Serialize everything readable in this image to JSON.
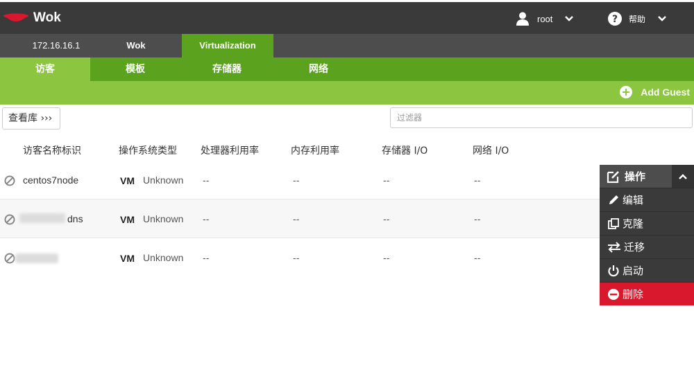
{
  "header": {
    "app_name": "Wok",
    "user": "root",
    "help_label": "帮助",
    "colors": {
      "topbar": "#3a3a3a",
      "logo": "#d9182d"
    }
  },
  "host_tabs": [
    {
      "label": "172.16.16.1"
    },
    {
      "label": "Wok"
    },
    {
      "label": "Virtualization",
      "active": true
    }
  ],
  "section_tabs": [
    {
      "label": "访客",
      "active": true
    },
    {
      "label": "模板"
    },
    {
      "label": "存储器"
    },
    {
      "label": "网络"
    }
  ],
  "actionbar": {
    "add_guest_label": "Add Guest"
  },
  "toolbar": {
    "gallery_label": "查看库 ›››",
    "filter_placeholder": "过滤器"
  },
  "table": {
    "columns": [
      "访客名称标识",
      "操作系统类型",
      "处理器利用率",
      "内存利用率",
      "存储器 I/O",
      "网络 I/O"
    ],
    "rows": [
      {
        "name": "centos7node",
        "os_badge": "VM",
        "os_type": "Unknown",
        "cpu": "--",
        "memory": "--",
        "storage_io": "--",
        "network_io": "--"
      },
      {
        "name": "dns",
        "os_badge": "VM",
        "os_type": "Unknown",
        "cpu": "--",
        "memory": "--",
        "storage_io": "--",
        "network_io": "--"
      },
      {
        "name": "",
        "os_badge": "VM",
        "os_type": "Unknown",
        "cpu": "--",
        "memory": "--",
        "storage_io": "--",
        "network_io": "--"
      }
    ]
  },
  "actions_menu": {
    "title": "操作",
    "items": [
      {
        "label": "编辑",
        "icon": "pencil-icon"
      },
      {
        "label": "克隆",
        "icon": "clone-icon"
      },
      {
        "label": "迁移",
        "icon": "migrate-icon"
      },
      {
        "label": "启动",
        "icon": "power-icon"
      },
      {
        "label": "删除",
        "icon": "minus-circle-icon",
        "danger": true
      }
    ]
  },
  "colors": {
    "primary_green": "#5ba21f",
    "light_green": "#8cc53f",
    "dark_gray": "#4d4d4d",
    "danger": "#d9182d"
  }
}
